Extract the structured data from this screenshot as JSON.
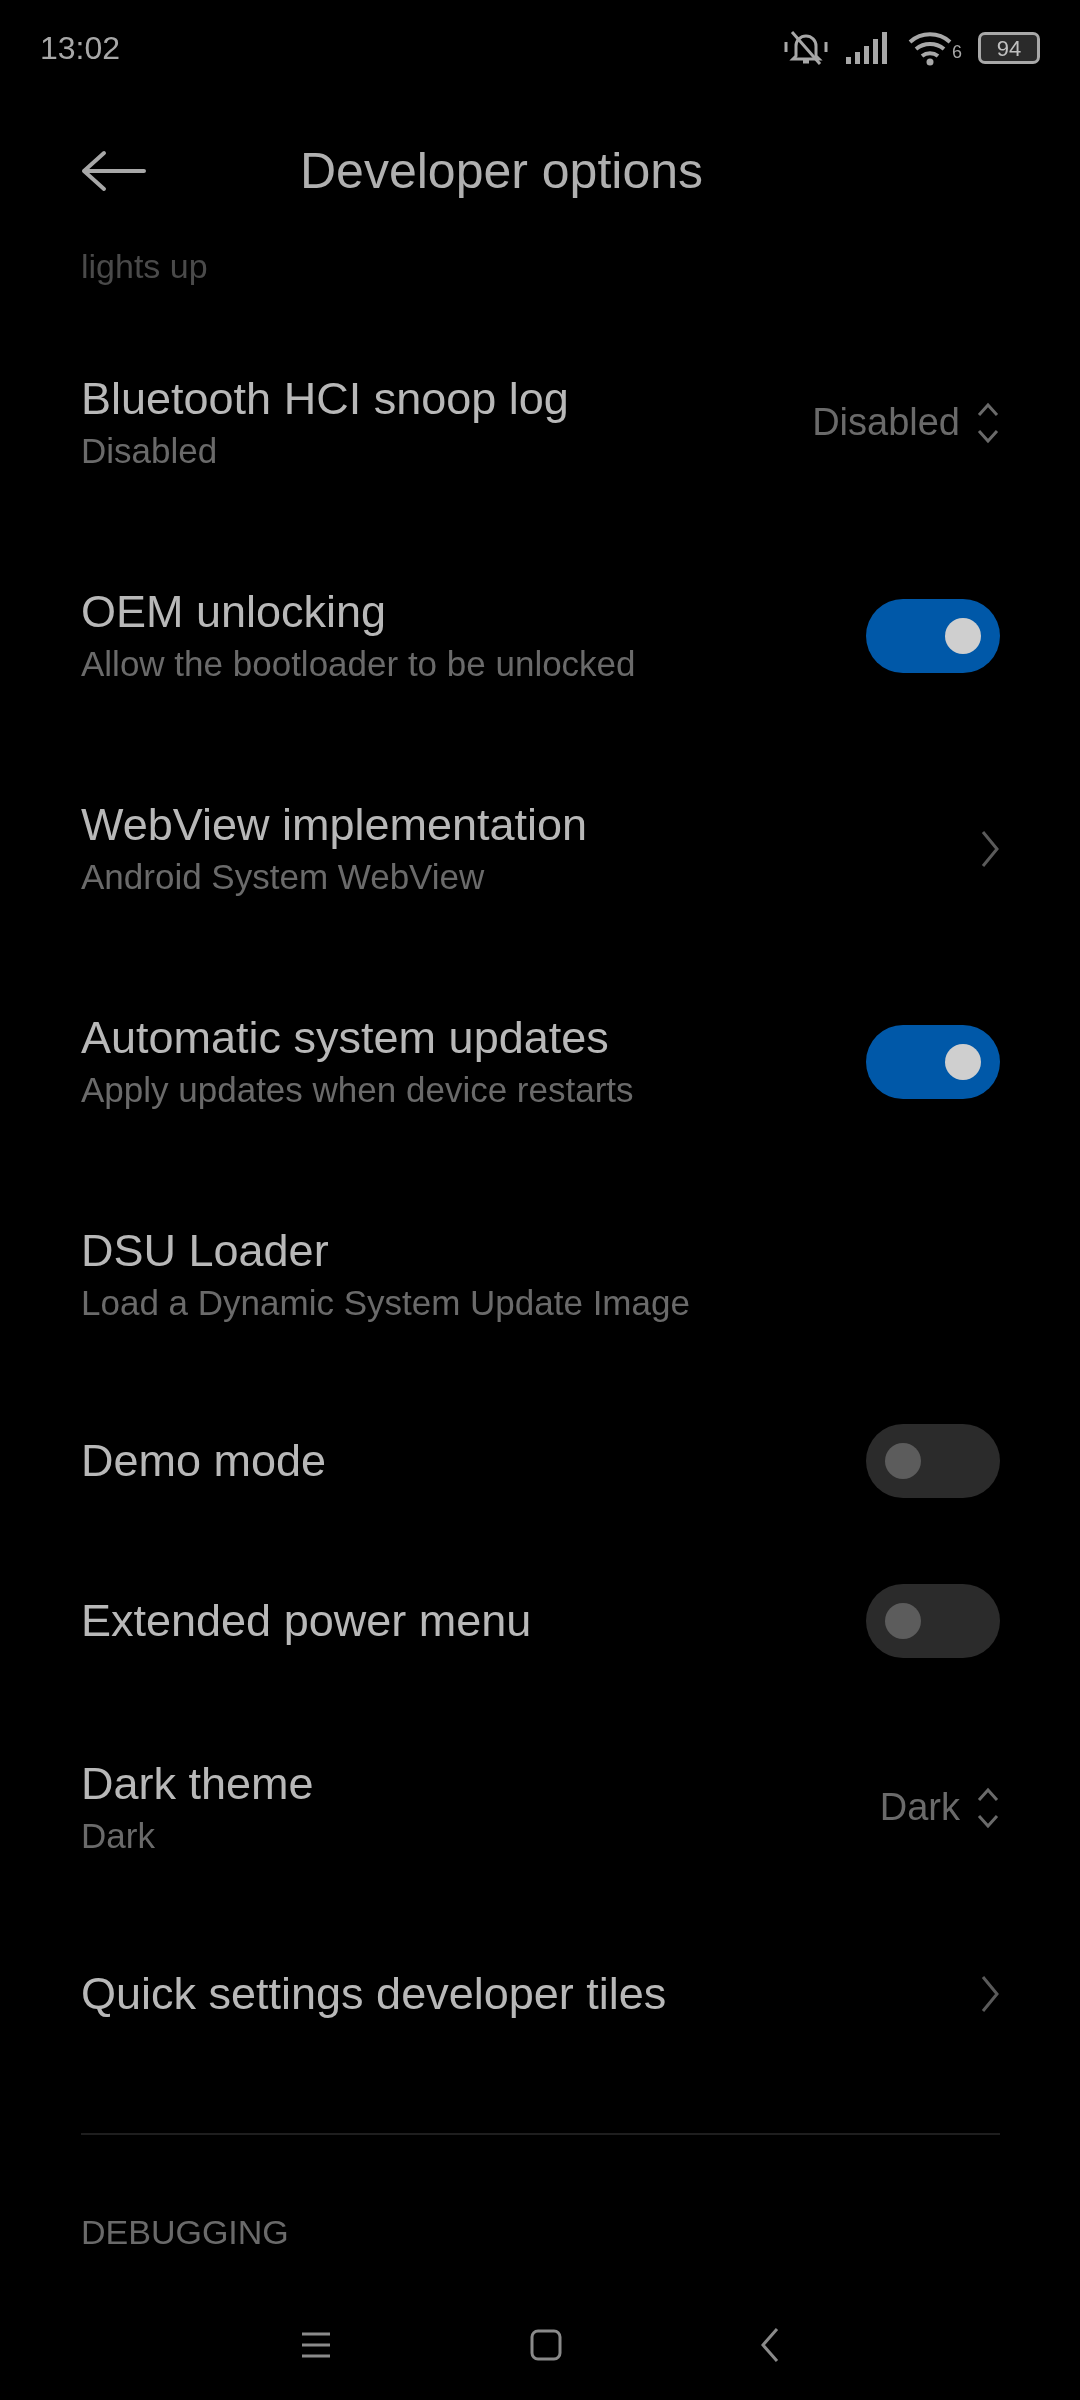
{
  "status_bar": {
    "time": "13:02",
    "battery": "94",
    "wifi_badge": "6"
  },
  "header": {
    "title": "Developer options"
  },
  "cut_text": "lights up",
  "settings": [
    {
      "kind": "dropdown",
      "title": "Bluetooth HCI snoop log",
      "subtitle": "Disabled",
      "value": "Disabled"
    },
    {
      "kind": "switch",
      "title": "OEM unlocking",
      "subtitle": "Allow the bootloader to be unlocked",
      "on": true
    },
    {
      "kind": "link",
      "title": "WebView implementation",
      "subtitle": "Android System WebView"
    },
    {
      "kind": "switch",
      "title": "Automatic system updates",
      "subtitle": "Apply updates when device restarts",
      "on": true
    },
    {
      "kind": "plain",
      "title": "DSU Loader",
      "subtitle": "Load a Dynamic System Update Image"
    },
    {
      "kind": "switch",
      "title": "Demo mode",
      "on": false
    },
    {
      "kind": "switch",
      "title": "Extended power menu",
      "on": false
    },
    {
      "kind": "dropdown",
      "title": "Dark theme",
      "subtitle": "Dark",
      "value": "Dark"
    },
    {
      "kind": "link",
      "title": "Quick settings developer tiles"
    }
  ],
  "section_header": "DEBUGGING"
}
